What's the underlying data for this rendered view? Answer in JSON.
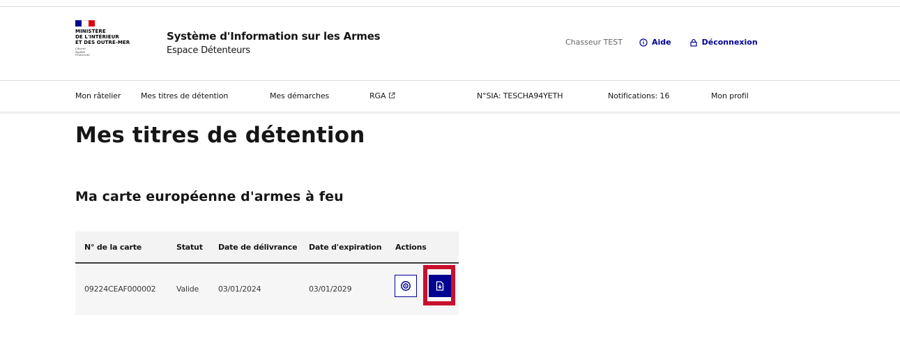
{
  "header": {
    "ministry_lines": [
      "Ministère",
      "de l'Intérieur",
      "et des Outre-Mer"
    ],
    "devise_lines": [
      "Liberté",
      "Égalité",
      "Fraternité"
    ],
    "service_title": "Système d'Information sur les Armes",
    "service_subtitle": "Espace Détenteurs",
    "user_name": "Chasseur TEST",
    "help_label": "Aide",
    "logout_label": "Déconnexion"
  },
  "nav": {
    "items": [
      {
        "label": "Mon râtelier"
      },
      {
        "label": "Mes titres de détention"
      },
      {
        "label": "Mes démarches"
      },
      {
        "label": "RGA"
      },
      {
        "label": "N°SIA: TESCHA94YETH"
      },
      {
        "label": "Notifications: 16"
      },
      {
        "label": "Mon profil"
      }
    ]
  },
  "main": {
    "page_title": "Mes titres de détention",
    "section_title": "Ma carte européenne d'armes à feu",
    "table": {
      "headers": [
        "N° de la carte",
        "Statut",
        "Date de délivrance",
        "Date d'expiration",
        "Actions"
      ],
      "rows": [
        [
          "09224CEAF000002",
          "Valide",
          "03/01/2024",
          "03/01/2029"
        ]
      ]
    }
  },
  "colors": {
    "accent_blue": "#000091",
    "highlight_red": "#c8102e",
    "flag_blue": "#000091",
    "flag_red": "#e1000f"
  },
  "icons": {
    "view": "eye-icon",
    "download": "download-file-icon",
    "help": "info-icon",
    "logout": "lock-icon",
    "external": "external-link-icon"
  }
}
